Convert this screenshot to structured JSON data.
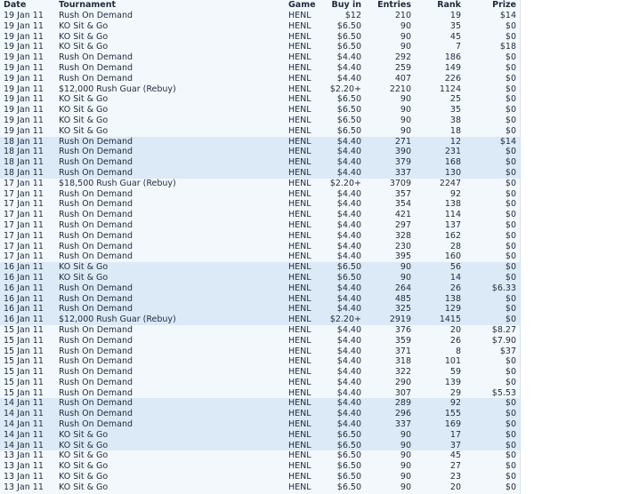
{
  "table": {
    "headers": [
      "Date",
      "Tournament",
      "Game",
      "Buy in",
      "Entries",
      "Rank",
      "Prize"
    ],
    "rows": [
      {
        "date": "19 Jan 11",
        "tournament": "Rush On Demand",
        "game": "HENL",
        "buyin": "$12",
        "entries": "210",
        "rank": "19",
        "prize": "$14",
        "group": 0
      },
      {
        "date": "19 Jan 11",
        "tournament": "KO Sit & Go",
        "game": "HENL",
        "buyin": "$6.50",
        "entries": "90",
        "rank": "35",
        "prize": "$0",
        "group": 0
      },
      {
        "date": "19 Jan 11",
        "tournament": "KO Sit & Go",
        "game": "HENL",
        "buyin": "$6.50",
        "entries": "90",
        "rank": "45",
        "prize": "$0",
        "group": 0
      },
      {
        "date": "19 Jan 11",
        "tournament": "KO Sit & Go",
        "game": "HENL",
        "buyin": "$6.50",
        "entries": "90",
        "rank": "7",
        "prize": "$18",
        "group": 0
      },
      {
        "date": "19 Jan 11",
        "tournament": "Rush On Demand",
        "game": "HENL",
        "buyin": "$4.40",
        "entries": "292",
        "rank": "186",
        "prize": "$0",
        "group": 0
      },
      {
        "date": "19 Jan 11",
        "tournament": "Rush On Demand",
        "game": "HENL",
        "buyin": "$4.40",
        "entries": "259",
        "rank": "149",
        "prize": "$0",
        "group": 0
      },
      {
        "date": "19 Jan 11",
        "tournament": "Rush On Demand",
        "game": "HENL",
        "buyin": "$4.40",
        "entries": "407",
        "rank": "226",
        "prize": "$0",
        "group": 0
      },
      {
        "date": "19 Jan 11",
        "tournament": "$12,000 Rush Guar (Rebuy)",
        "game": "HENL",
        "buyin": "$2.20+",
        "entries": "2210",
        "rank": "1124",
        "prize": "$0",
        "group": 0
      },
      {
        "date": "19 Jan 11",
        "tournament": "KO Sit & Go",
        "game": "HENL",
        "buyin": "$6.50",
        "entries": "90",
        "rank": "25",
        "prize": "$0",
        "group": 0
      },
      {
        "date": "19 Jan 11",
        "tournament": "KO Sit & Go",
        "game": "HENL",
        "buyin": "$6.50",
        "entries": "90",
        "rank": "35",
        "prize": "$0",
        "group": 0
      },
      {
        "date": "19 Jan 11",
        "tournament": "KO Sit & Go",
        "game": "HENL",
        "buyin": "$6.50",
        "entries": "90",
        "rank": "38",
        "prize": "$0",
        "group": 0
      },
      {
        "date": "19 Jan 11",
        "tournament": "KO Sit & Go",
        "game": "HENL",
        "buyin": "$6.50",
        "entries": "90",
        "rank": "18",
        "prize": "$0",
        "group": 0
      },
      {
        "date": "18 Jan 11",
        "tournament": "Rush On Demand",
        "game": "HENL",
        "buyin": "$4.40",
        "entries": "271",
        "rank": "12",
        "prize": "$14",
        "group": 1
      },
      {
        "date": "18 Jan 11",
        "tournament": "Rush On Demand",
        "game": "HENL",
        "buyin": "$4.40",
        "entries": "390",
        "rank": "231",
        "prize": "$0",
        "group": 1
      },
      {
        "date": "18 Jan 11",
        "tournament": "Rush On Demand",
        "game": "HENL",
        "buyin": "$4.40",
        "entries": "379",
        "rank": "168",
        "prize": "$0",
        "group": 1
      },
      {
        "date": "18 Jan 11",
        "tournament": "Rush On Demand",
        "game": "HENL",
        "buyin": "$4.40",
        "entries": "337",
        "rank": "130",
        "prize": "$0",
        "group": 1
      },
      {
        "date": "17 Jan 11",
        "tournament": "$18,500 Rush Guar (Rebuy)",
        "game": "HENL",
        "buyin": "$2.20+",
        "entries": "3709",
        "rank": "2247",
        "prize": "$0",
        "group": 0
      },
      {
        "date": "17 Jan 11",
        "tournament": "Rush On Demand",
        "game": "HENL",
        "buyin": "$4.40",
        "entries": "357",
        "rank": "92",
        "prize": "$0",
        "group": 0
      },
      {
        "date": "17 Jan 11",
        "tournament": "Rush On Demand",
        "game": "HENL",
        "buyin": "$4.40",
        "entries": "354",
        "rank": "138",
        "prize": "$0",
        "group": 0
      },
      {
        "date": "17 Jan 11",
        "tournament": "Rush On Demand",
        "game": "HENL",
        "buyin": "$4.40",
        "entries": "421",
        "rank": "114",
        "prize": "$0",
        "group": 0
      },
      {
        "date": "17 Jan 11",
        "tournament": "Rush On Demand",
        "game": "HENL",
        "buyin": "$4.40",
        "entries": "297",
        "rank": "137",
        "prize": "$0",
        "group": 0
      },
      {
        "date": "17 Jan 11",
        "tournament": "Rush On Demand",
        "game": "HENL",
        "buyin": "$4.40",
        "entries": "328",
        "rank": "162",
        "prize": "$0",
        "group": 0
      },
      {
        "date": "17 Jan 11",
        "tournament": "Rush On Demand",
        "game": "HENL",
        "buyin": "$4.40",
        "entries": "230",
        "rank": "28",
        "prize": "$0",
        "group": 0
      },
      {
        "date": "17 Jan 11",
        "tournament": "Rush On Demand",
        "game": "HENL",
        "buyin": "$4.40",
        "entries": "395",
        "rank": "160",
        "prize": "$0",
        "group": 0
      },
      {
        "date": "16 Jan 11",
        "tournament": "KO Sit & Go",
        "game": "HENL",
        "buyin": "$6.50",
        "entries": "90",
        "rank": "56",
        "prize": "$0",
        "group": 1
      },
      {
        "date": "16 Jan 11",
        "tournament": "KO Sit & Go",
        "game": "HENL",
        "buyin": "$6.50",
        "entries": "90",
        "rank": "14",
        "prize": "$0",
        "group": 1
      },
      {
        "date": "16 Jan 11",
        "tournament": "Rush On Demand",
        "game": "HENL",
        "buyin": "$4.40",
        "entries": "264",
        "rank": "26",
        "prize": "$6.33",
        "group": 1
      },
      {
        "date": "16 Jan 11",
        "tournament": "Rush On Demand",
        "game": "HENL",
        "buyin": "$4.40",
        "entries": "485",
        "rank": "138",
        "prize": "$0",
        "group": 1
      },
      {
        "date": "16 Jan 11",
        "tournament": "Rush On Demand",
        "game": "HENL",
        "buyin": "$4.40",
        "entries": "325",
        "rank": "129",
        "prize": "$0",
        "group": 1
      },
      {
        "date": "16 Jan 11",
        "tournament": "$12,000 Rush Guar (Rebuy)",
        "game": "HENL",
        "buyin": "$2.20+",
        "entries": "2919",
        "rank": "1415",
        "prize": "$0",
        "group": 1
      },
      {
        "date": "15 Jan 11",
        "tournament": "Rush On Demand",
        "game": "HENL",
        "buyin": "$4.40",
        "entries": "376",
        "rank": "20",
        "prize": "$8.27",
        "group": 0
      },
      {
        "date": "15 Jan 11",
        "tournament": "Rush On Demand",
        "game": "HENL",
        "buyin": "$4.40",
        "entries": "359",
        "rank": "26",
        "prize": "$7.90",
        "group": 0
      },
      {
        "date": "15 Jan 11",
        "tournament": "Rush On Demand",
        "game": "HENL",
        "buyin": "$4.40",
        "entries": "371",
        "rank": "8",
        "prize": "$37",
        "group": 0
      },
      {
        "date": "15 Jan 11",
        "tournament": "Rush On Demand",
        "game": "HENL",
        "buyin": "$4.40",
        "entries": "318",
        "rank": "101",
        "prize": "$0",
        "group": 0
      },
      {
        "date": "15 Jan 11",
        "tournament": "Rush On Demand",
        "game": "HENL",
        "buyin": "$4.40",
        "entries": "322",
        "rank": "59",
        "prize": "$0",
        "group": 0
      },
      {
        "date": "15 Jan 11",
        "tournament": "Rush On Demand",
        "game": "HENL",
        "buyin": "$4.40",
        "entries": "290",
        "rank": "139",
        "prize": "$0",
        "group": 0
      },
      {
        "date": "15 Jan 11",
        "tournament": "Rush On Demand",
        "game": "HENL",
        "buyin": "$4.40",
        "entries": "307",
        "rank": "29",
        "prize": "$5.53",
        "group": 0
      },
      {
        "date": "14 Jan 11",
        "tournament": "Rush On Demand",
        "game": "HENL",
        "buyin": "$4.40",
        "entries": "289",
        "rank": "92",
        "prize": "$0",
        "group": 1
      },
      {
        "date": "14 Jan 11",
        "tournament": "Rush On Demand",
        "game": "HENL",
        "buyin": "$4.40",
        "entries": "296",
        "rank": "155",
        "prize": "$0",
        "group": 1
      },
      {
        "date": "14 Jan 11",
        "tournament": "Rush On Demand",
        "game": "HENL",
        "buyin": "$4.40",
        "entries": "337",
        "rank": "169",
        "prize": "$0",
        "group": 1
      },
      {
        "date": "14 Jan 11",
        "tournament": "KO Sit & Go",
        "game": "HENL",
        "buyin": "$6.50",
        "entries": "90",
        "rank": "17",
        "prize": "$0",
        "group": 1
      },
      {
        "date": "14 Jan 11",
        "tournament": "KO Sit & Go",
        "game": "HENL",
        "buyin": "$6.50",
        "entries": "90",
        "rank": "37",
        "prize": "$0",
        "group": 1
      },
      {
        "date": "13 Jan 11",
        "tournament": "KO Sit & Go",
        "game": "HENL",
        "buyin": "$6.50",
        "entries": "90",
        "rank": "45",
        "prize": "$0",
        "group": 0
      },
      {
        "date": "13 Jan 11",
        "tournament": "KO Sit & Go",
        "game": "HENL",
        "buyin": "$6.50",
        "entries": "90",
        "rank": "27",
        "prize": "$0",
        "group": 0
      },
      {
        "date": "13 Jan 11",
        "tournament": "KO Sit & Go",
        "game": "HENL",
        "buyin": "$6.50",
        "entries": "90",
        "rank": "23",
        "prize": "$0",
        "group": 0
      },
      {
        "date": "13 Jan 11",
        "tournament": "KO Sit & Go",
        "game": "HENL",
        "buyin": "$6.50",
        "entries": "90",
        "rank": "20",
        "prize": "$0",
        "group": 0
      }
    ]
  },
  "colors": {
    "row_light": "#f3f8fd",
    "row_shaded": "#dce9f6",
    "text": "#1f2b3a",
    "page_bg": "#ffffff"
  }
}
